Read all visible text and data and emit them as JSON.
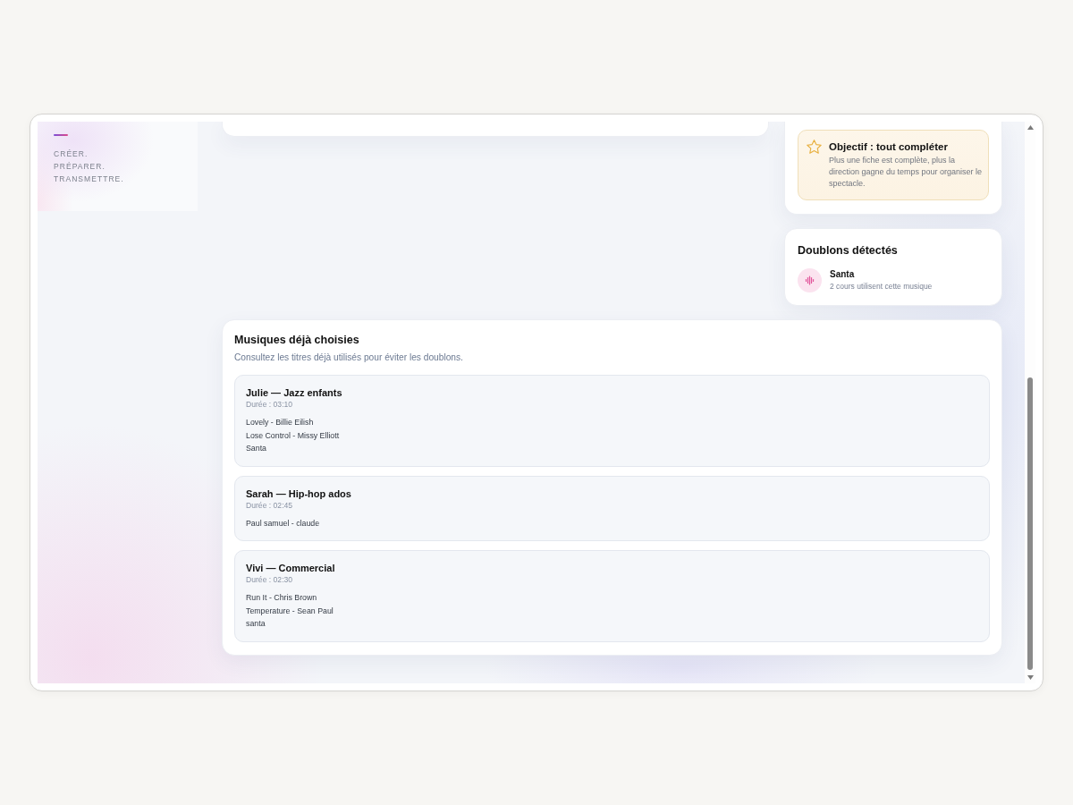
{
  "sidebar": {
    "tagline": [
      "CRÉER.",
      "PRÉPARER.",
      "TRANSMETTRE."
    ]
  },
  "goal_tip": {
    "title": "Objectif : tout compléter",
    "text": "Plus une fiche est complète, plus la direction gagne du temps pour organiser le spectacle."
  },
  "duplicates": {
    "title": "Doublons détectés",
    "items": [
      {
        "title": "Santa",
        "detail": "2 cours utilisent cette musique"
      }
    ]
  },
  "chosen_music": {
    "title": "Musiques déjà choisies",
    "subtitle": "Consultez les titres déjà utilisés pour éviter les doublons.",
    "courses": [
      {
        "title": "Julie — Jazz enfants",
        "duration": "Durée : 03:10",
        "songs": [
          "Lovely - Billie Eilish",
          "Lose Control - Missy Elliott",
          "Santa"
        ]
      },
      {
        "title": "Sarah — Hip-hop ados",
        "duration": "Durée : 02:45",
        "songs": [
          "Paul samuel - claude"
        ]
      },
      {
        "title": "Vivi — Commercial",
        "duration": "Durée : 02:30",
        "songs": [
          "Run It - Chris Brown",
          "Temperature - Sean Paul",
          "santa"
        ]
      }
    ]
  }
}
